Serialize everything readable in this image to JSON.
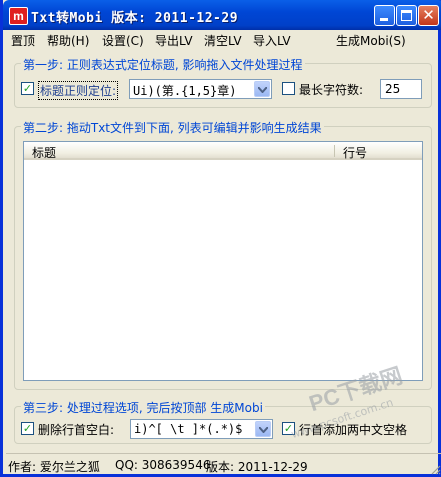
{
  "window": {
    "title": "Txt转Mobi  版本: 2011-12-29",
    "icon_letter": "m",
    "controls": {
      "minimize": "minimize-icon",
      "maximize": "maximize-icon",
      "close": "✕"
    }
  },
  "menubar": {
    "items": [
      "置顶",
      "帮助(H)",
      "设置(C)",
      "导出LV",
      "清空LV",
      "导入LV",
      "生成Mobi(S)"
    ]
  },
  "step1": {
    "legend": "第一步: 正则表达式定位标题, 影响拖入文件处理过程",
    "regex_check": {
      "label": "标题正则定位:",
      "checked": true,
      "mark": "✓"
    },
    "regex_combo": {
      "value": "Ui)(第.{1,5}章)"
    },
    "maxlen_check": {
      "label": "最长字符数:",
      "checked": false,
      "mark": ""
    },
    "maxlen_value": "25"
  },
  "step2": {
    "legend": "第二步: 拖动Txt文件到下面, 列表可编辑并影响生成结果",
    "columns": [
      "标题",
      "行号"
    ],
    "rows": []
  },
  "step3": {
    "legend": "第三步: 处理过程选项, 完后按顶部 生成Mobi",
    "trim_check": {
      "label": "删除行首空白:",
      "checked": true,
      "mark": "✓"
    },
    "trim_combo": {
      "value": "i)^[ \\t  ]*(.*)$"
    },
    "indent_check": {
      "label": "行首添加两中文空格",
      "checked": true,
      "mark": "✓"
    }
  },
  "statusbar": {
    "author": "作者: 爱尔兰之狐",
    "qq": "QQ: 308639546",
    "version": "版本: 2011-12-29"
  },
  "watermark": {
    "main": "PC下载网",
    "url": "www.pcsoft.com.cn"
  },
  "colors": {
    "title_bar": "#0046D5",
    "legend_text": "#0046D5",
    "check_mark": "#21A121",
    "background": "#ECE9D8"
  }
}
